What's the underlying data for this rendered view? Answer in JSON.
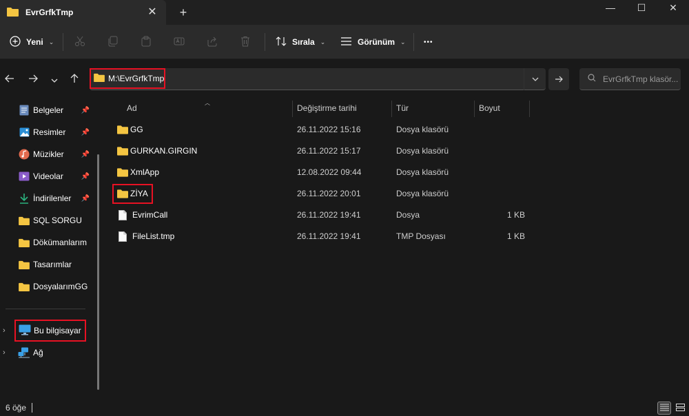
{
  "window": {
    "tab_title": "EvrGrfkTmp",
    "close_tab_symbol": "✕",
    "new_tab_symbol": "+",
    "minimize_symbol": "—",
    "maximize_symbol": "☐",
    "close_symbol": "✕"
  },
  "toolbar": {
    "new_label": "Yeni",
    "sort_label": "Sırala",
    "view_label": "Görünüm",
    "more_symbol": "•••",
    "icons": [
      "plus-circle-icon",
      "cut-icon",
      "copy-icon",
      "paste-icon",
      "rename-icon",
      "share-icon",
      "delete-icon",
      "sort-icon",
      "view-icon",
      "more-icon"
    ]
  },
  "address": {
    "path": "M:\\EvrGrfkTmp",
    "search_placeholder": "EvrGrfkTmp klasör..."
  },
  "sidebar": {
    "items": [
      {
        "label": "Belgeler",
        "icon": "documents-icon",
        "pinned": true
      },
      {
        "label": "Resimler",
        "icon": "pictures-icon",
        "pinned": true
      },
      {
        "label": "Müzikler",
        "icon": "music-icon",
        "pinned": true
      },
      {
        "label": "Videolar",
        "icon": "videos-icon",
        "pinned": true
      },
      {
        "label": "İndirilenler",
        "icon": "downloads-icon",
        "pinned": true
      },
      {
        "label": "SQL SORGU",
        "icon": "folder-icon",
        "pinned": false
      },
      {
        "label": "Dökümanlarım",
        "icon": "folder-icon",
        "pinned": false
      },
      {
        "label": "Tasarımlar",
        "icon": "folder-icon",
        "pinned": false
      },
      {
        "label": "DosyalarımGG",
        "icon": "folder-icon",
        "pinned": false
      }
    ],
    "this_pc": "Bu bilgisayar",
    "network": "Ağ"
  },
  "columns": {
    "name": "Ad",
    "date": "Değiştirme tarihi",
    "type": "Tür",
    "size": "Boyut"
  },
  "files": [
    {
      "name": "GG",
      "date": "26.11.2022 15:16",
      "type": "Dosya klasörü",
      "size": "",
      "kind": "folder"
    },
    {
      "name": "GURKAN.GIRGIN",
      "date": "26.11.2022 15:17",
      "type": "Dosya klasörü",
      "size": "",
      "kind": "folder"
    },
    {
      "name": "XmlApp",
      "date": "12.08.2022 09:44",
      "type": "Dosya klasörü",
      "size": "",
      "kind": "folder"
    },
    {
      "name": "ZİYA",
      "date": "26.11.2022 20:01",
      "type": "Dosya klasörü",
      "size": "",
      "kind": "folder"
    },
    {
      "name": "EvrimCall",
      "date": "26.11.2022 19:41",
      "type": "Dosya",
      "size": "1 KB",
      "kind": "file"
    },
    {
      "name": "FileList.tmp",
      "date": "26.11.2022 19:41",
      "type": "TMP Dosyası",
      "size": "1 KB",
      "kind": "file"
    }
  ],
  "status": {
    "item_count": "6 öğe"
  },
  "colors": {
    "folder": "#f4c542",
    "highlight": "#e81123",
    "background": "#191919"
  }
}
